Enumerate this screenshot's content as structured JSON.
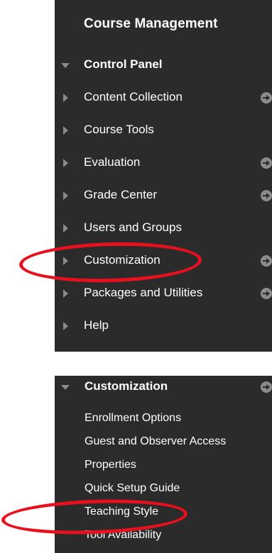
{
  "top_panel": {
    "heading": "Course Management",
    "items": [
      {
        "label": "Control Panel",
        "expanded": true,
        "has_arrow": false
      },
      {
        "label": "Content Collection",
        "expanded": false,
        "has_arrow": true
      },
      {
        "label": "Course Tools",
        "expanded": false,
        "has_arrow": false
      },
      {
        "label": "Evaluation",
        "expanded": false,
        "has_arrow": true
      },
      {
        "label": "Grade Center",
        "expanded": false,
        "has_arrow": true
      },
      {
        "label": "Users and Groups",
        "expanded": false,
        "has_arrow": false
      },
      {
        "label": "Customization",
        "expanded": false,
        "has_arrow": true
      },
      {
        "label": "Packages and Utilities",
        "expanded": false,
        "has_arrow": true
      },
      {
        "label": "Help",
        "expanded": false,
        "has_arrow": false
      }
    ]
  },
  "bottom_panel": {
    "heading": "Customization",
    "items": [
      {
        "label": "Enrollment Options"
      },
      {
        "label": "Guest and Observer Access"
      },
      {
        "label": "Properties"
      },
      {
        "label": "Quick Setup Guide"
      },
      {
        "label": "Teaching Style"
      },
      {
        "label": "Tool Availability"
      }
    ]
  },
  "highlights": {
    "color": "#e8101e",
    "circled_items": [
      "Customization",
      "Teaching Style"
    ]
  },
  "colors": {
    "panel_background": "#2b2b2b",
    "text": "#ffffff",
    "icon": "#8a8a8a"
  }
}
